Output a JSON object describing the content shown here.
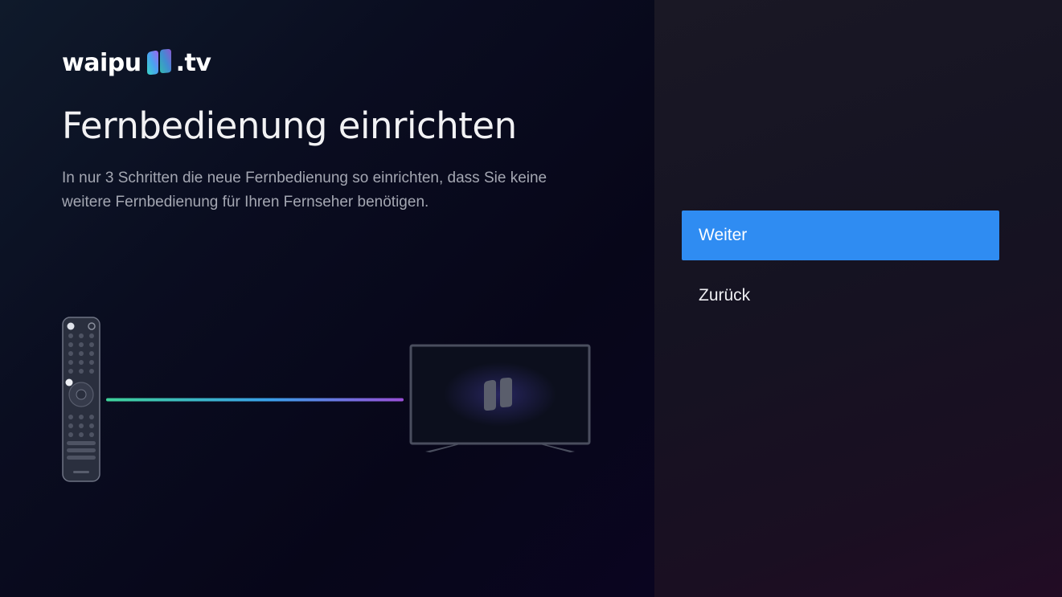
{
  "app": {
    "logo_prefix": "waipu",
    "logo_suffix": ".tv",
    "logo_mark_icon": "waipu-logo-mark"
  },
  "setup": {
    "title": "Fernbedienung einrichten",
    "description": "In nur 3 Schritten die neue Fernbedienung so einrichten, dass Sie keine weitere Fernbedienung für Ihren Fernseher benötigen."
  },
  "illustration": {
    "remote_icon": "remote-control-icon",
    "signal_icon": "signal-line",
    "tv_icon": "tv-icon",
    "signal_colors": [
      "#3fd39a",
      "#3aa0ea",
      "#9a4fd8"
    ]
  },
  "actions": {
    "primary_label": "Weiter",
    "secondary_label": "Zurück",
    "primary_color": "#2f8cf2"
  }
}
